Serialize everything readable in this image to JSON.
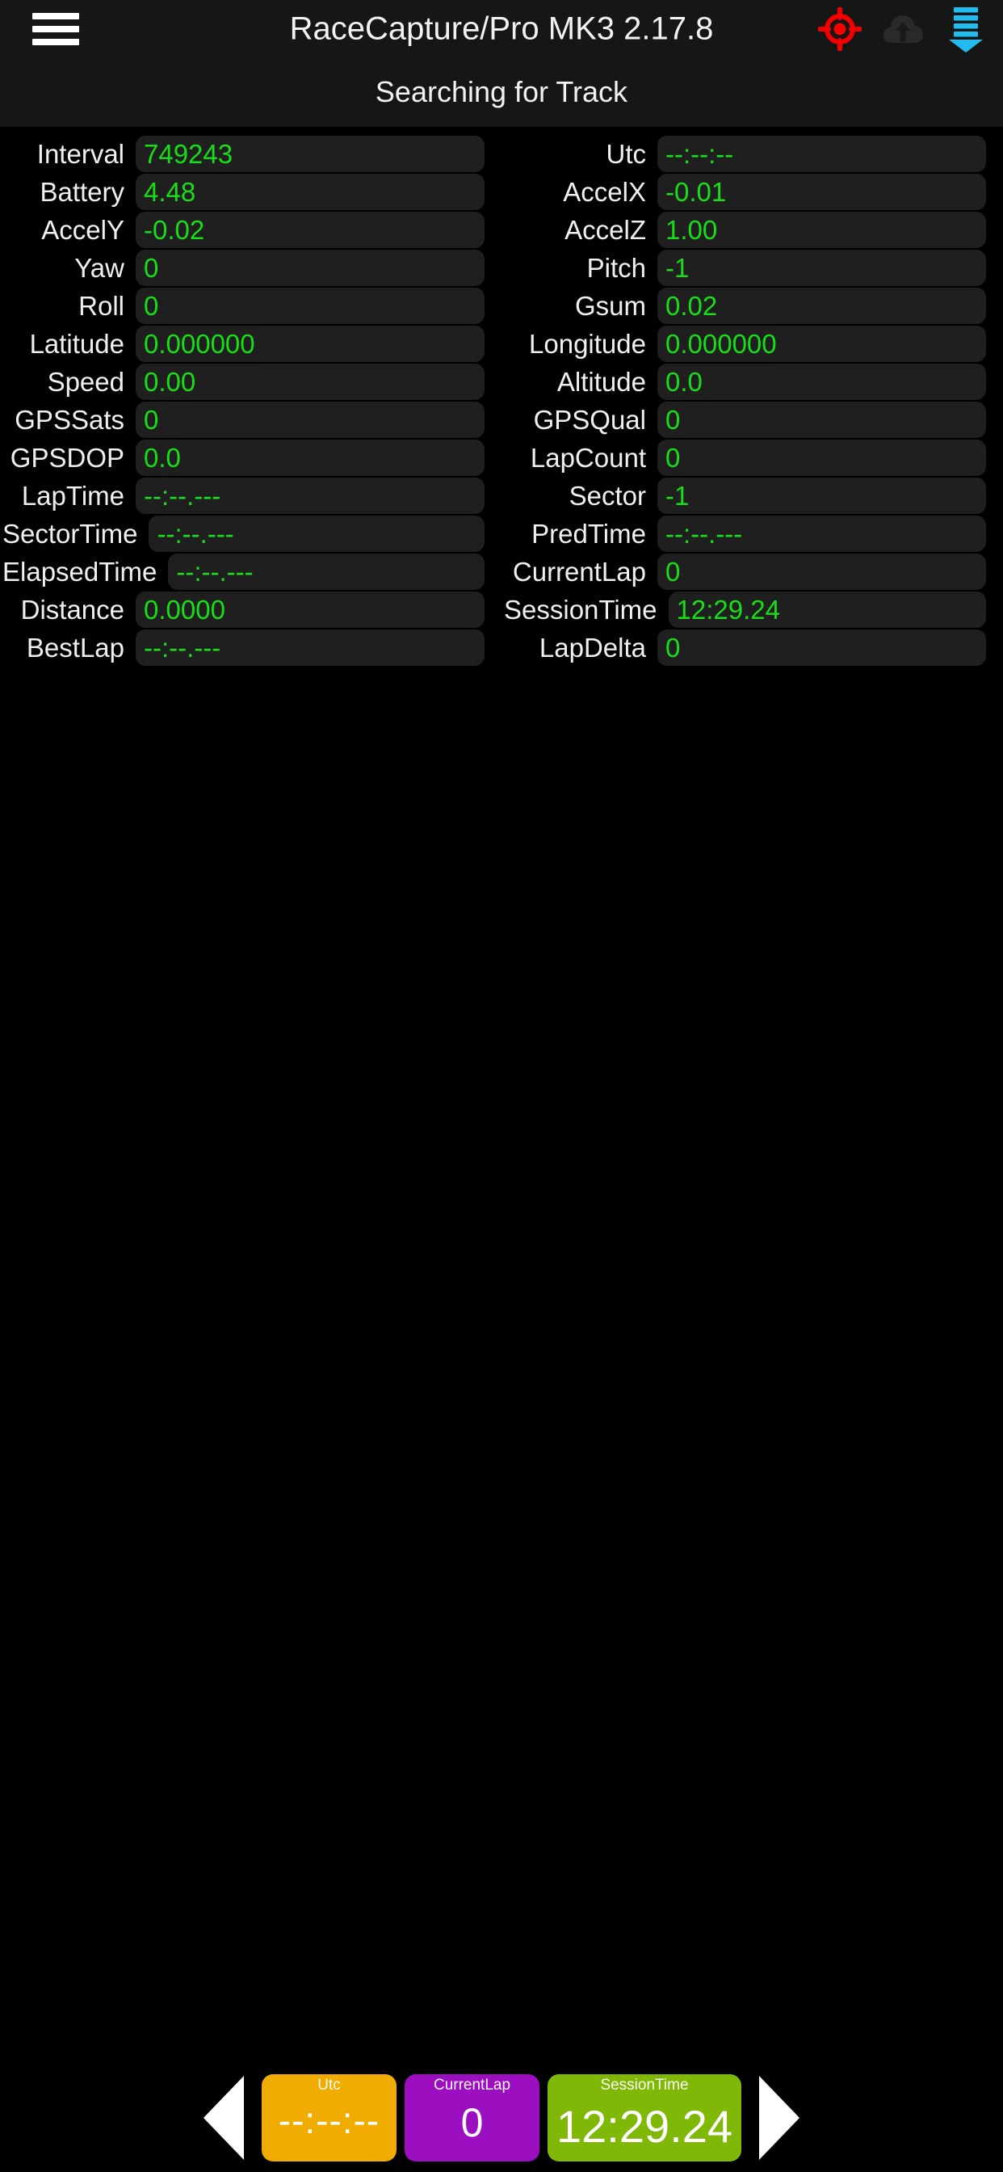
{
  "header": {
    "menu_icon": "hamburger-menu-icon",
    "title": "RaceCapture/Pro MK3 2.17.8",
    "status": {
      "gps_icon": "gps-target-icon",
      "gps_color": "#f40000",
      "cloud_icon": "cloud-upload-icon",
      "cloud_color": "#2a2a2a",
      "telemetry_icon": "telemetry-download-icon",
      "telemetry_color": "#22bdf0"
    },
    "subtitle": "Searching for Track"
  },
  "channels": {
    "value_color": "#19dd19",
    "label_color": "#f0f0f0",
    "rows": [
      {
        "left": {
          "label": "Interval",
          "value": "749243"
        },
        "right": {
          "label": "Utc",
          "value": "--:--:--"
        }
      },
      {
        "left": {
          "label": "Battery",
          "value": "4.48"
        },
        "right": {
          "label": "AccelX",
          "value": "-0.01"
        }
      },
      {
        "left": {
          "label": "AccelY",
          "value": "-0.02"
        },
        "right": {
          "label": "AccelZ",
          "value": "1.00"
        }
      },
      {
        "left": {
          "label": "Yaw",
          "value": "0"
        },
        "right": {
          "label": "Pitch",
          "value": "-1"
        }
      },
      {
        "left": {
          "label": "Roll",
          "value": "0"
        },
        "right": {
          "label": "Gsum",
          "value": "0.02"
        }
      },
      {
        "left": {
          "label": "Latitude",
          "value": "0.000000"
        },
        "right": {
          "label": "Longitude",
          "value": "0.000000"
        }
      },
      {
        "left": {
          "label": "Speed",
          "value": "0.00"
        },
        "right": {
          "label": "Altitude",
          "value": "0.0"
        }
      },
      {
        "left": {
          "label": "GPSSats",
          "value": "0"
        },
        "right": {
          "label": "GPSQual",
          "value": "0"
        }
      },
      {
        "left": {
          "label": "GPSDOP",
          "value": "0.0"
        },
        "right": {
          "label": "LapCount",
          "value": "0"
        }
      },
      {
        "left": {
          "label": "LapTime",
          "value": "--:--.---"
        },
        "right": {
          "label": "Sector",
          "value": "-1"
        }
      },
      {
        "left": {
          "label": "SectorTime",
          "value": "--:--.---"
        },
        "right": {
          "label": "PredTime",
          "value": "--:--.---"
        }
      },
      {
        "left": {
          "label": "ElapsedTime",
          "value": "--:--.---"
        },
        "right": {
          "label": "CurrentLap",
          "value": "0"
        }
      },
      {
        "left": {
          "label": "Distance",
          "value": "0.0000"
        },
        "right": {
          "label": "SessionTime",
          "value": "12:29.24"
        }
      },
      {
        "left": {
          "label": "BestLap",
          "value": "--:--.---"
        },
        "right": {
          "label": "LapDelta",
          "value": "0"
        }
      }
    ]
  },
  "bottombar": {
    "prev_icon": "arrow-left-icon",
    "next_icon": "arrow-right-icon",
    "tiles": [
      {
        "label": "Utc",
        "value": "--:--:--",
        "color": "#f0ac00"
      },
      {
        "label": "CurrentLap",
        "value": "0",
        "color": "#9c0fc0"
      },
      {
        "label": "SessionTime",
        "value": "12:29.24",
        "color": "#80b808"
      }
    ]
  }
}
